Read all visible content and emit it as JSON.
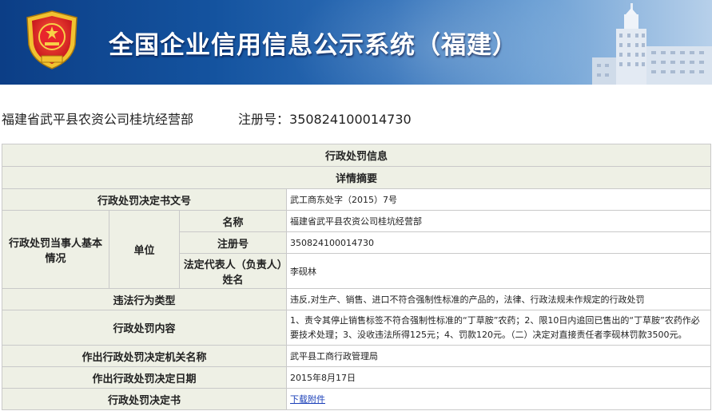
{
  "header": {
    "title": "全国企业信用信息公示系统（福建）",
    "emblem_icon": "national-emblem-icon",
    "building_icon": "building-icon"
  },
  "company": {
    "name": "福建省武平县农资公司桂坑经营部",
    "reg_label": "注册号：",
    "reg_number": "350824100014730"
  },
  "table": {
    "section_title": "行政处罚信息",
    "subsection_title": "详情摘要",
    "rows": {
      "decision_no_label": "行政处罚决定书文号",
      "decision_no_value": "武工商东处字（2015）7号",
      "party_label": "行政处罚当事人基本情况",
      "unit_label": "单位",
      "name_label": "名称",
      "name_value": "福建省武平县农资公司桂坑经营部",
      "reg_label": "注册号",
      "reg_value": "350824100014730",
      "rep_label": "法定代表人（负责人）姓名",
      "rep_value": "李砚林",
      "violation_label": "违法行为类型",
      "violation_value": "违反,对生产、销售、进口不符合强制性标准的产品的，法律、行政法规未作规定的行政处罚",
      "content_label": "行政处罚内容",
      "content_value": "1、责令其停止销售标签不符合强制性标准的“丁草胺”农药；2、限10日内追回已售出的“丁草胺”农药作必要技术处理；3、没收违法所得125元；4、罚款120元。（二）决定对直接责任者李砚林罚款3500元。",
      "authority_label": "作出行政处罚决定机关名称",
      "authority_value": "武平县工商行政管理局",
      "date_label": "作出行政处罚决定日期",
      "date_value": "2015年8月17日",
      "document_label": "行政处罚决定书",
      "document_link": "下载附件"
    }
  },
  "colors": {
    "banner_dark": "#0c3e86",
    "banner_light": "#b7d0ea",
    "label_bg": "#eef0e5",
    "border": "#c9c9c9",
    "link": "#1a3fb8"
  }
}
